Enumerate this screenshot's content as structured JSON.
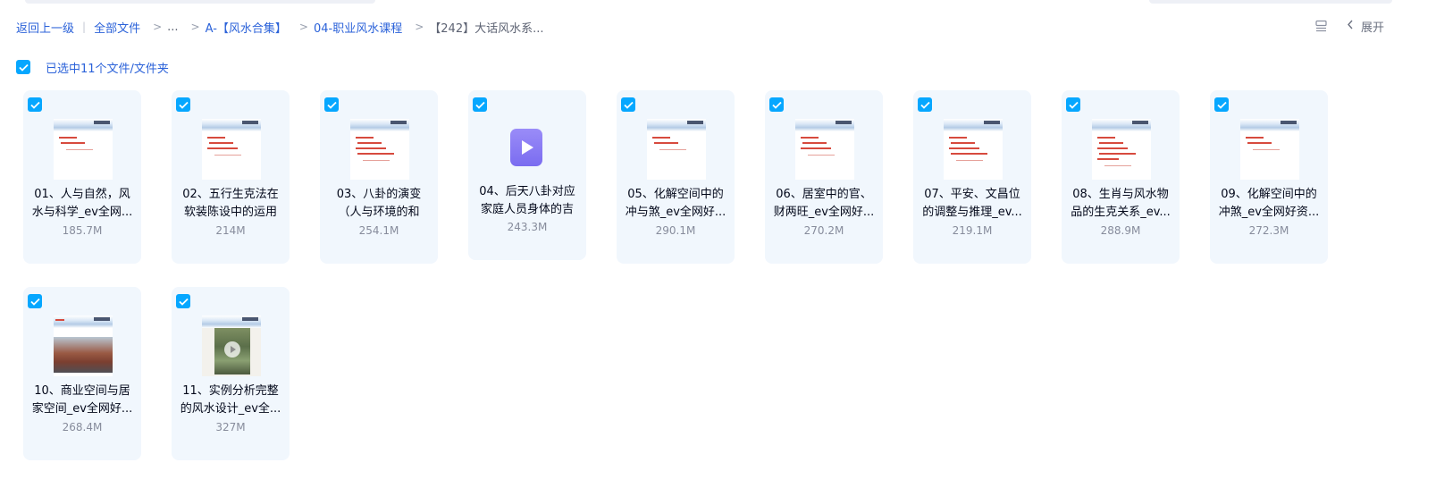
{
  "breadcrumb": {
    "back": "返回上一级",
    "all_files": "全部文件",
    "ellipsis": "...",
    "level1": "A-【风水合集】",
    "level2": "04-职业风水课程",
    "current": "【242】大话风水系..."
  },
  "toolbar": {
    "list_icon": "list-view-icon",
    "expand_label": "展开",
    "expand_icon": "chevron-left-icon"
  },
  "selection": {
    "text": "已选中11个文件/文件夹",
    "checked": true
  },
  "files": [
    {
      "name": "01、人与自然，风水与科学_ev全网...",
      "size": "185.7M",
      "type": "slide"
    },
    {
      "name": "02、五行生克法在软装陈设中的运用",
      "size": "214M",
      "type": "slide"
    },
    {
      "name": "03、八卦的演变（人与环境的和",
      "size": "254.1M",
      "type": "slide"
    },
    {
      "name": "04、后天八卦对应家庭人员身体的吉",
      "size": "243.3M",
      "type": "video"
    },
    {
      "name": "05、化解空间中的冲与煞_ev全网好...",
      "size": "290.1M",
      "type": "slide"
    },
    {
      "name": "06、居室中的官、财两旺_ev全网好...",
      "size": "270.2M",
      "type": "slide"
    },
    {
      "name": "07、平安、文昌位的调整与推理_ev...",
      "size": "219.1M",
      "type": "slide"
    },
    {
      "name": "08、生肖与风水物品的生克关系_ev...",
      "size": "288.9M",
      "type": "slide"
    },
    {
      "name": "09、化解空间中的冲煞_ev全网好资...",
      "size": "272.3M",
      "type": "slide"
    },
    {
      "name": "10、商业空间与居家空间_ev全网好...",
      "size": "268.4M",
      "type": "photo"
    },
    {
      "name": "11、实例分析完整的风水设计_ev全...",
      "size": "327M",
      "type": "plan"
    }
  ],
  "colors": {
    "accent": "#06a7ff",
    "link": "#2b62d9",
    "card_bg": "#f1f7fd",
    "video_icon": "#8b7cf6"
  }
}
